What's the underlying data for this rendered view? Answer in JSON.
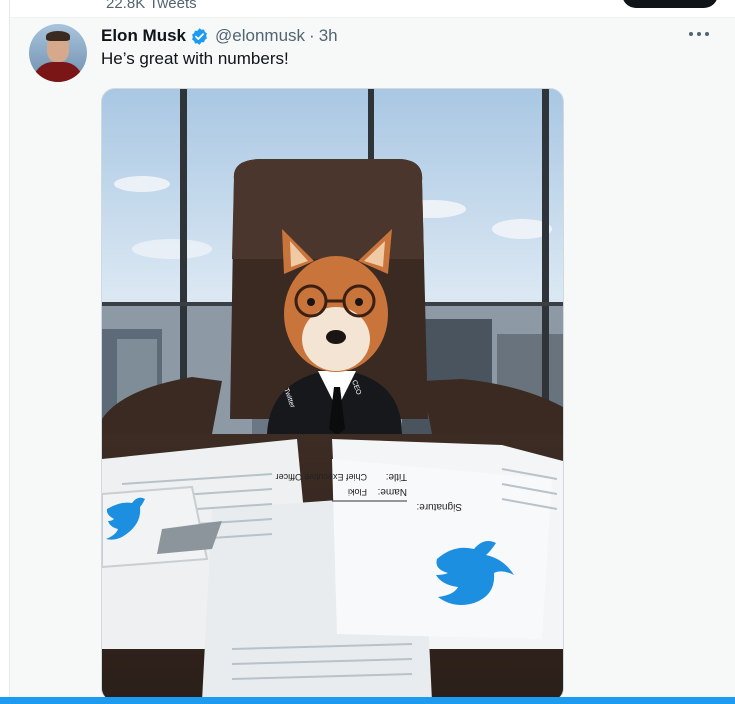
{
  "profile_header": {
    "tweets_count": "22.8K Tweets"
  },
  "tweet": {
    "author": {
      "display_name": "Elon Musk",
      "verified": true,
      "handle": "@elonmusk",
      "separator": "·",
      "time": "3h"
    },
    "text": "He’s great with numbers!",
    "more_icon": "more-horizontal-icon",
    "media": {
      "doc_labels": {
        "signature": "Signature:",
        "name": "Name:",
        "name_value": "Floki",
        "title": "Title:",
        "title_value": "Chief Executive Officer"
      },
      "tie_label": "Twitter",
      "lapel_label": "CEO"
    }
  },
  "colors": {
    "accent": "#1d9bf0",
    "text_primary": "#0f1419",
    "text_secondary": "#536471",
    "tweet_bg": "#f7f9f9"
  }
}
